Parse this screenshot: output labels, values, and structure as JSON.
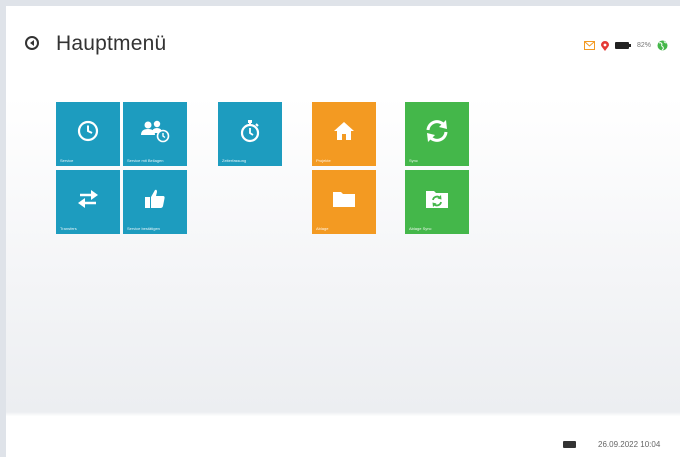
{
  "header": {
    "title": "Hauptmenü",
    "battery_percent": "82%",
    "icons": [
      "back-icon",
      "mail-icon",
      "location-icon",
      "battery-icon",
      "globe-icon"
    ]
  },
  "tiles": [
    {
      "label": "Service",
      "icon": "clock-icon",
      "color": "#1d9cbf"
    },
    {
      "label": "Service mit Beilagen",
      "icon": "users-clock-icon",
      "color": "#1d9cbf"
    },
    {
      "label": "Zeiterfassung",
      "icon": "stopwatch-icon",
      "color": "#1d9cbf"
    },
    {
      "label": "Projekte",
      "icon": "home-icon",
      "color": "#f39a22"
    },
    {
      "label": "Sync",
      "icon": "sync-icon",
      "color": "#44b74a"
    },
    {
      "label": "Transfers",
      "icon": "transfer-icon",
      "color": "#1d9cbf"
    },
    {
      "label": "Service bestätigen",
      "icon": "thumbs-up-icon",
      "color": "#1d9cbf"
    },
    {
      "label": "Ablage",
      "icon": "folder-icon",
      "color": "#f39a22"
    },
    {
      "label": "Ablage Sync",
      "icon": "folder-sync-icon",
      "color": "#44b74a"
    }
  ],
  "footer": {
    "datetime": "26.09.2022 10:04",
    "keyboard_icon": "keyboard-icon"
  }
}
